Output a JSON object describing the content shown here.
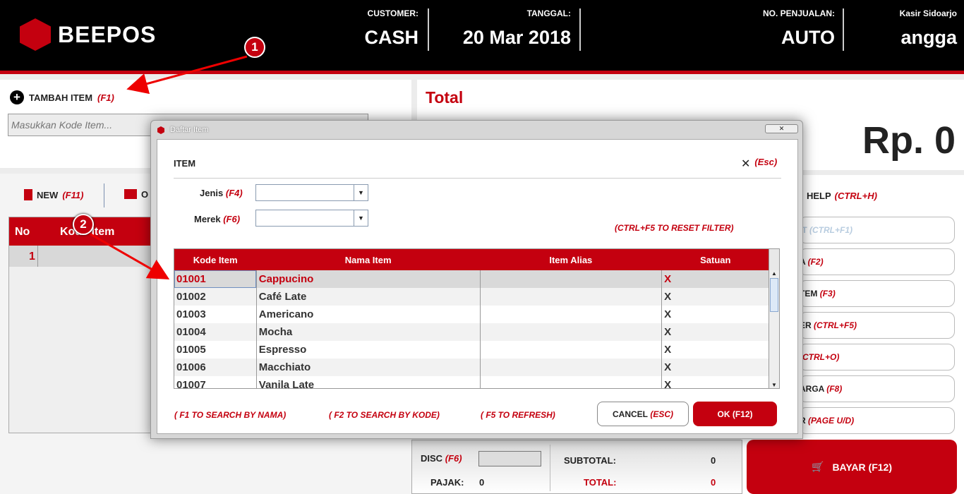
{
  "header": {
    "brand": "BEEPOS",
    "customer_label": "CUSTOMER:",
    "customer": "CASH",
    "tanggal_label": "TANGGAL:",
    "tanggal": "20 Mar 2018",
    "no_label": "NO. PENJUALAN:",
    "no": "AUTO",
    "kasir_label": "Kasir Sidoarjo",
    "kasir": "angga"
  },
  "left": {
    "tambah_label": "TAMBAH ITEM",
    "tambah_key": "(F1)",
    "input_placeholder": "Masukkan Kode Item...",
    "new_label": "NEW",
    "new_key": "(F11)",
    "open_label": "O",
    "col_no": "No",
    "col_kode": "Kode Item",
    "row_no": "1"
  },
  "right": {
    "total_label": "Total",
    "total_value": "Rp. 0",
    "help_label": "HELP",
    "help_key": "(CTRL+H)",
    "buttons": [
      {
        "text": "IT",
        "key": "(CTRL+F1)",
        "disabled": true
      },
      {
        "text": "A",
        "key": "(F2)"
      },
      {
        "text": "TEM",
        "key": "(F3)"
      },
      {
        "text": "ER",
        "key": "(CTRL+F5)"
      },
      {
        "text": "",
        "key": "(CTRL+O)"
      },
      {
        "text": "ARGA",
        "key": "(F8)"
      },
      {
        "text": "R",
        "key": "(PAGE U/D)"
      }
    ],
    "bayar": "BAYAR (F12)"
  },
  "footer": {
    "disc_label": "DISC",
    "disc_key": "(F6)",
    "pajak_label": "PAJAK:",
    "pajak": "0",
    "subtotal_label": "SUBTOTAL:",
    "subtotal": "0",
    "total_label": "TOTAL:",
    "total": "0"
  },
  "dialog": {
    "title": "Daftar Item",
    "heading": "ITEM",
    "close_key": "(Esc)",
    "jenis_label": "Jenis",
    "jenis_key": "(F4)",
    "merek_label": "Merek",
    "merek_key": "(F6)",
    "reset_hint": "(CTRL+F5 TO RESET FILTER)",
    "columns": [
      "Kode Item",
      "Nama Item",
      "Item Alias",
      "Satuan"
    ],
    "rows": [
      [
        "01001",
        "Cappucino",
        "",
        "X"
      ],
      [
        "01002",
        "Café Late",
        "",
        "X"
      ],
      [
        "01003",
        "Americano",
        "",
        "X"
      ],
      [
        "01004",
        "Mocha",
        "",
        "X"
      ],
      [
        "01005",
        "Espresso",
        "",
        "X"
      ],
      [
        "01006",
        "Macchiato",
        "",
        "X"
      ],
      [
        "01007",
        "Vanila Late",
        "",
        "X"
      ]
    ],
    "hint1": "( F1 TO SEARCH BY NAMA)",
    "hint2": "( F2 TO SEARCH BY KODE)",
    "hint3": "( F5 TO REFRESH)",
    "cancel_label": "CANCEL",
    "cancel_key": "(ESC)",
    "ok_label": "OK (F12)"
  },
  "annotations": [
    "1",
    "2"
  ],
  "colors": {
    "accent": "#c4000f",
    "header": "#000000"
  }
}
